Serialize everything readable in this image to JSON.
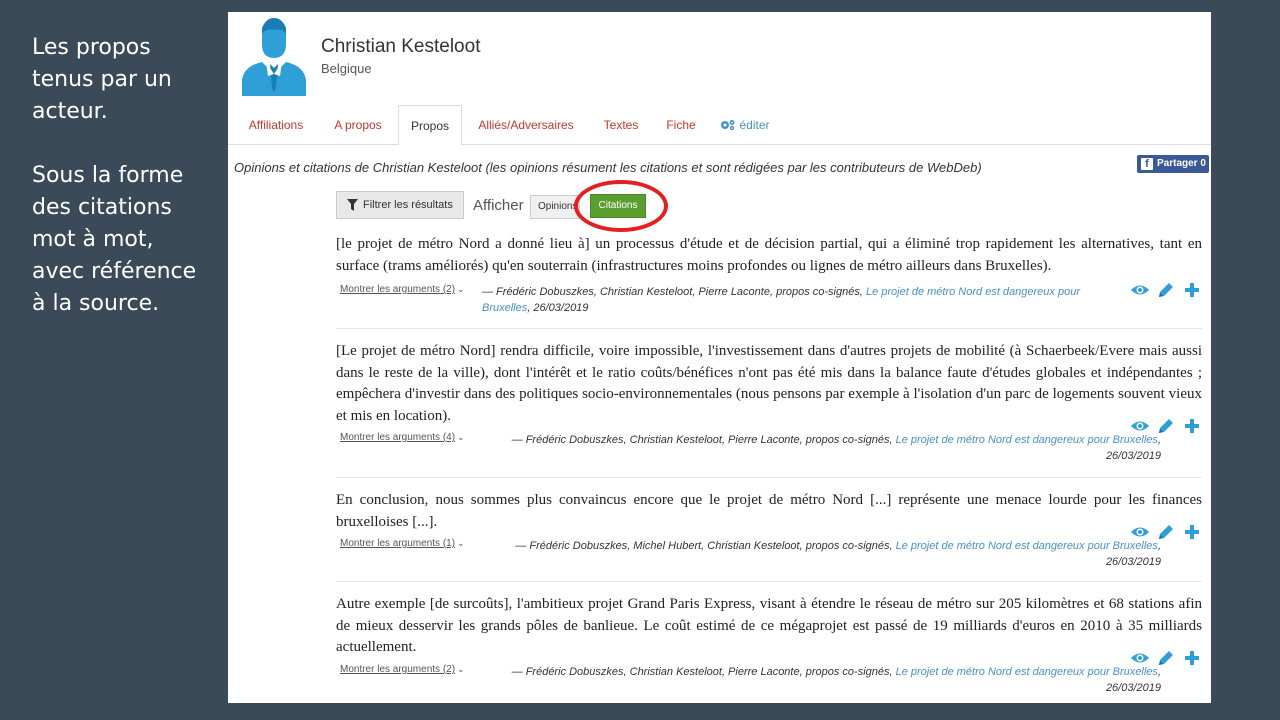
{
  "slide_note": {
    "paragraph1": "Les propos\ntenus par un\nacteur.",
    "paragraph2": "Sous la forme\ndes citations\nmot à mot,\navec référence\nà la source."
  },
  "profile": {
    "name": "Christian Kesteloot",
    "country": "Belgique"
  },
  "tabs": [
    {
      "label": "Affiliations"
    },
    {
      "label": "A propos"
    },
    {
      "label": "Propos"
    },
    {
      "label": "Alliés/Adversaires"
    },
    {
      "label": "Textes"
    },
    {
      "label": "Fiche"
    },
    {
      "label": "éditer"
    }
  ],
  "intro_text": "Opinions et citations de Christian Kesteloot (les opinions résument les citations et sont rédigées par les contributeurs de WebDeb)",
  "share_label": "Partager 0",
  "toolbar": {
    "filter_label": "Filtrer les résultats",
    "show_label": "Afficher",
    "opinions_label": "Opinions",
    "citations_label": "Citations"
  },
  "citations": [
    {
      "text": "[le projet de métro Nord a donné lieu à] un processus d'étude et de décision partial, qui a éliminé trop rapidement les alternatives, tant en surface (trams améliorés) qu'en souterrain (infrastructures moins profondes ou lignes de métro ailleurs dans Bruxelles).",
      "args_label": "Montrer les arguments (2)",
      "authors": "— Frédéric Dobuszkes, Christian Kesteloot, Pierre Laconte",
      "cosigned": ", propos co-signés, ",
      "source": "Le projet de métro Nord est dangereux pour Bruxelles",
      "date": ", 26/03/2019"
    },
    {
      "text": "[Le projet de métro Nord] rendra difficile, voire impossible, l'investissement dans d'autres projets de mobilité (à Schaerbeek/Evere mais aussi dans le reste de la ville), dont l'intérêt et le ratio coûts/bénéfices n'ont pas été mis dans la balance faute d'études globales et indépendantes ; empêchera d'investir dans des politiques socio-environnementales (nous pensons par exemple à l'isolation d'un parc de logements souvent vieux et mis en location).",
      "args_label": "Montrer les arguments (4)",
      "authors": "— Frédéric Dobuszkes, Christian Kesteloot, Pierre Laconte",
      "cosigned": ", propos co-signés, ",
      "source": "Le projet de métro Nord est dangereux pour Bruxelles",
      "date": ", 26/03/2019"
    },
    {
      "text": "En conclusion, nous sommes plus convaincus encore que le projet de métro Nord [...] représente une menace lourde pour les finances bruxelloises [...].",
      "args_label": "Montrer les arguments (1)",
      "authors": "— Frédéric Dobuszkes, Michel Hubert, Christian Kesteloot",
      "cosigned": ", propos co-signés, ",
      "source": "Le projet de métro Nord est dangereux pour Bruxelles",
      "date": ", 26/03/2019"
    },
    {
      "text": "Autre exemple [de surcoûts], l'ambitieux projet Grand Paris Express, visant à étendre le réseau de métro sur 205 kilomètres et 68 stations afin de mieux desservir les grands pôles de banlieue. Le coût estimé de ce mégaprojet est passé de 19 milliards d'euros en 2010 à 35 milliards actuellement.",
      "args_label": "Montrer les arguments (2)",
      "authors": "— Frédéric Dobuszkes, Christian Kesteloot, Pierre Laconte",
      "cosigned": ", propos co-signés, ",
      "source": "Le projet de métro Nord est dangereux pour Bruxelles",
      "date": ", 26/03/2019"
    }
  ],
  "colors": {
    "slide_bg": "#3b4a58",
    "link": "#c0392b",
    "accent_blue": "#4a90c8",
    "citations_green": "#5a9e2f",
    "highlight_red": "#e32020"
  },
  "icons": [
    "avatar-icon",
    "cogs-icon",
    "facebook-icon",
    "filter-icon",
    "eye-icon",
    "pencil-icon",
    "plus-icon",
    "chevron-down-icon"
  ]
}
